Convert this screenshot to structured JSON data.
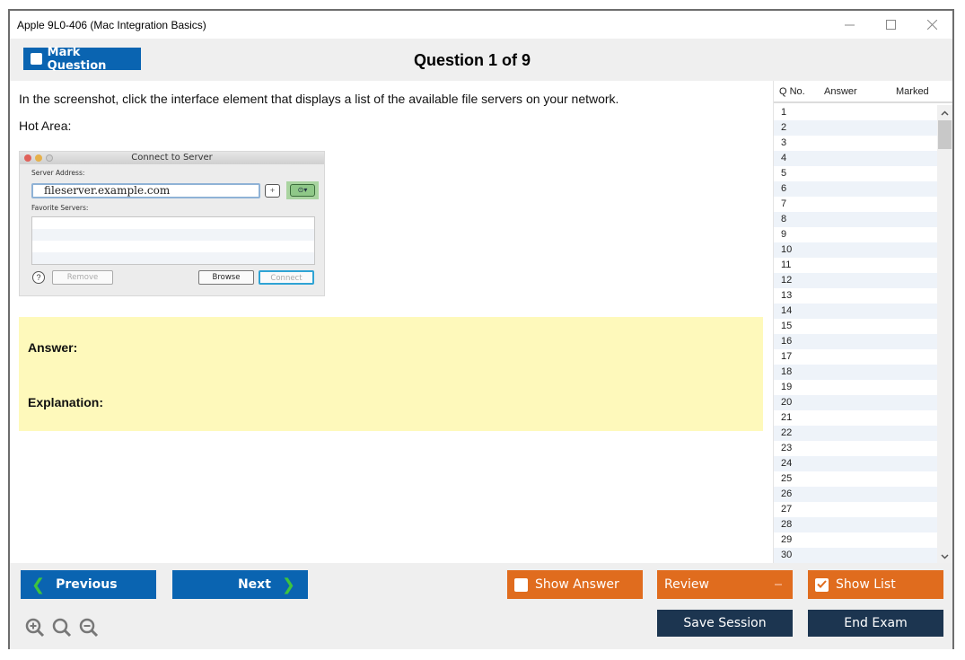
{
  "window": {
    "title": "Apple 9L0-406 (Mac Integration Basics)",
    "controls": [
      "minimize-icon",
      "maximize-icon",
      "close-icon"
    ]
  },
  "header": {
    "mark_question_label": "Mark Question",
    "mark_question_checked": false,
    "question_counter": "Question 1 of 9"
  },
  "question": {
    "text": "In the screenshot, click the interface element that displays a list of the available file servers on your network.",
    "hot_area_label": "Hot Area:",
    "dialog": {
      "title": "Connect to Server",
      "server_address_label": "Server Address:",
      "server_address_value": "fileserver.example.com",
      "plus_button": "+",
      "browse_menu_icon": "⊙▾",
      "favorite_servers_label": "Favorite Servers:",
      "help_button": "?",
      "remove_button": "Remove",
      "browse_button": "Browse",
      "connect_button": "Connect"
    }
  },
  "answer_panel": {
    "answer_label": "Answer:",
    "explanation_label": "Explanation:"
  },
  "question_list": {
    "headers": [
      "Q No.",
      "Answer",
      "Marked"
    ],
    "rows": [
      "1",
      "2",
      "3",
      "4",
      "5",
      "6",
      "7",
      "8",
      "9",
      "10",
      "11",
      "12",
      "13",
      "14",
      "15",
      "16",
      "17",
      "18",
      "19",
      "20",
      "21",
      "22",
      "23",
      "24",
      "25",
      "26",
      "27",
      "28",
      "29",
      "30"
    ]
  },
  "footer": {
    "previous_label": "Previous",
    "next_label": "Next",
    "show_answer_label": "Show Answer",
    "show_answer_checked": false,
    "review_label": "Review",
    "show_list_label": "Show List",
    "show_list_checked": true,
    "save_session_label": "Save Session",
    "end_exam_label": "End Exam",
    "zoom_icons": [
      "zoom-in-icon",
      "zoom-reset-icon",
      "zoom-out-icon"
    ]
  },
  "colors": {
    "primary_blue": "#0a64b1",
    "orange": "#e06c1e",
    "navy": "#1c3550",
    "answer_bg": "#fef9bb",
    "chevron_green": "#3ec43e"
  }
}
